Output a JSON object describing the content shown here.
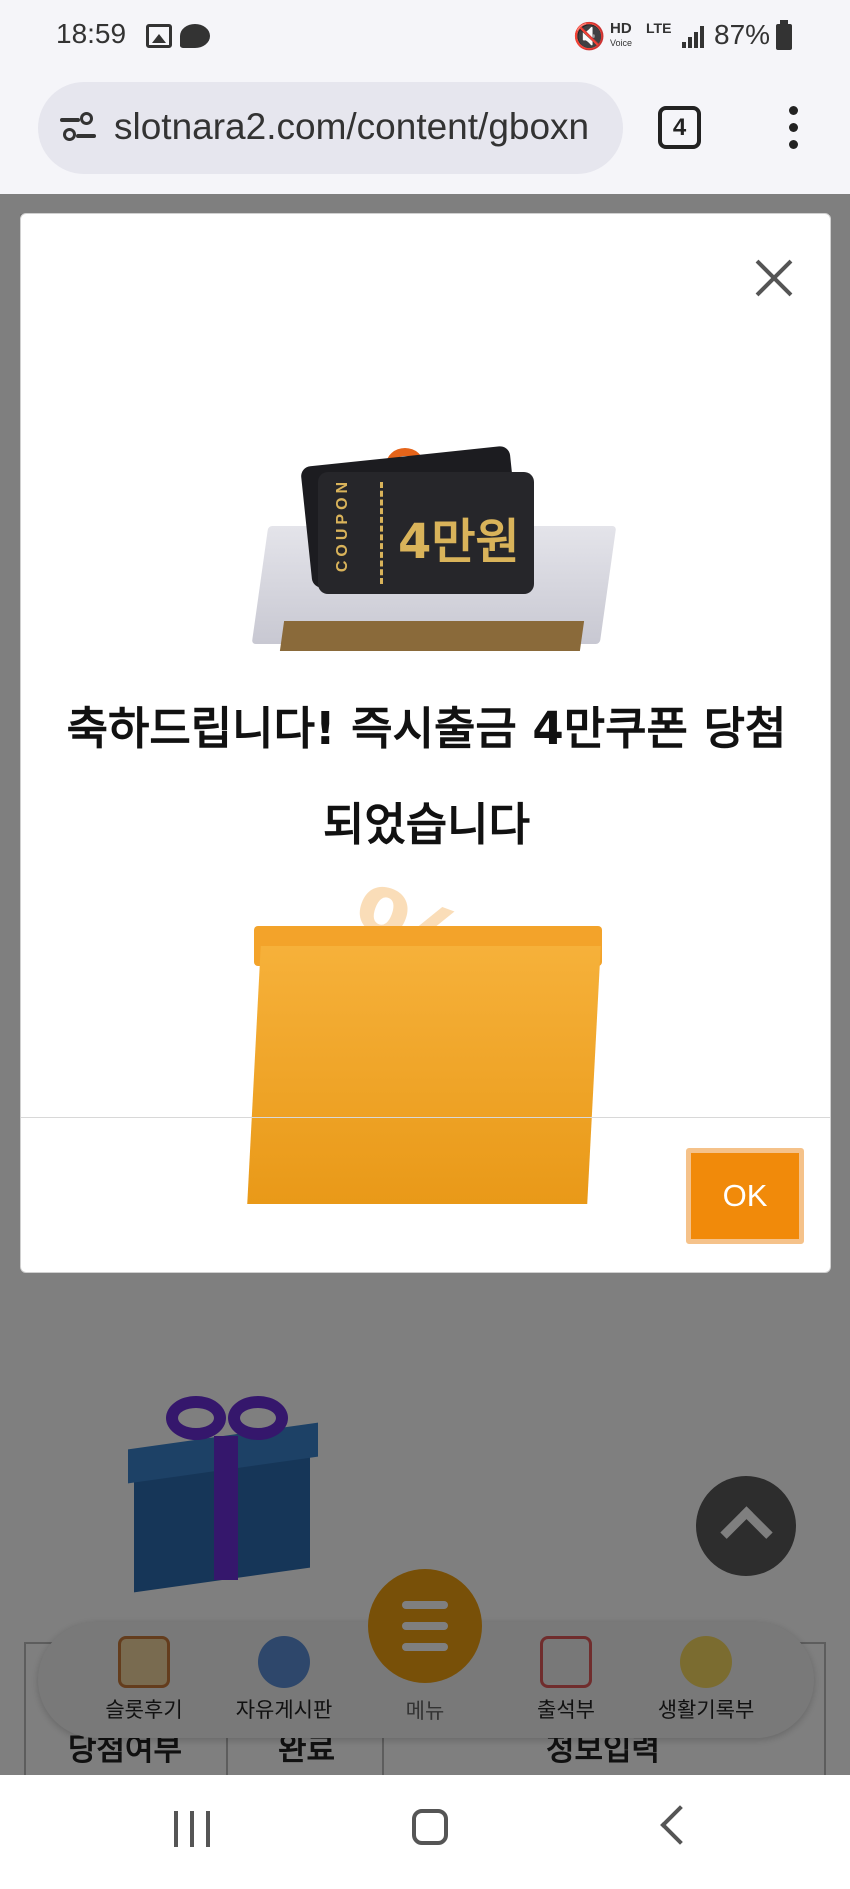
{
  "status_bar": {
    "time": "18:59",
    "hd_label": "HD",
    "hd_sub": "Voice",
    "lte_label": "LTE",
    "battery": "87%"
  },
  "browser": {
    "url": "slotnara2.com/content/gboxn",
    "tab_count": "4"
  },
  "modal": {
    "coupon_side_text": "COUPON",
    "coupon_value": "4만원",
    "message_line1": "축하드립니다! 즉시출금 4만쿠폰 당첨",
    "message_line2": "되었습니다",
    "ok_label": "OK",
    "accent_color": "#f18a0a"
  },
  "page": {
    "table_headers": [
      "당첨여부",
      "완료",
      "정보입력"
    ]
  },
  "bottom_nav": {
    "items": [
      {
        "label": "슬롯후기",
        "icon": "review-icon"
      },
      {
        "label": "자유게시판",
        "icon": "chat-icon"
      },
      {
        "label": "메뉴",
        "icon": "menu-icon"
      },
      {
        "label": "출석부",
        "icon": "calendar-icon"
      },
      {
        "label": "생활기록부",
        "icon": "emoji-icon"
      }
    ]
  }
}
